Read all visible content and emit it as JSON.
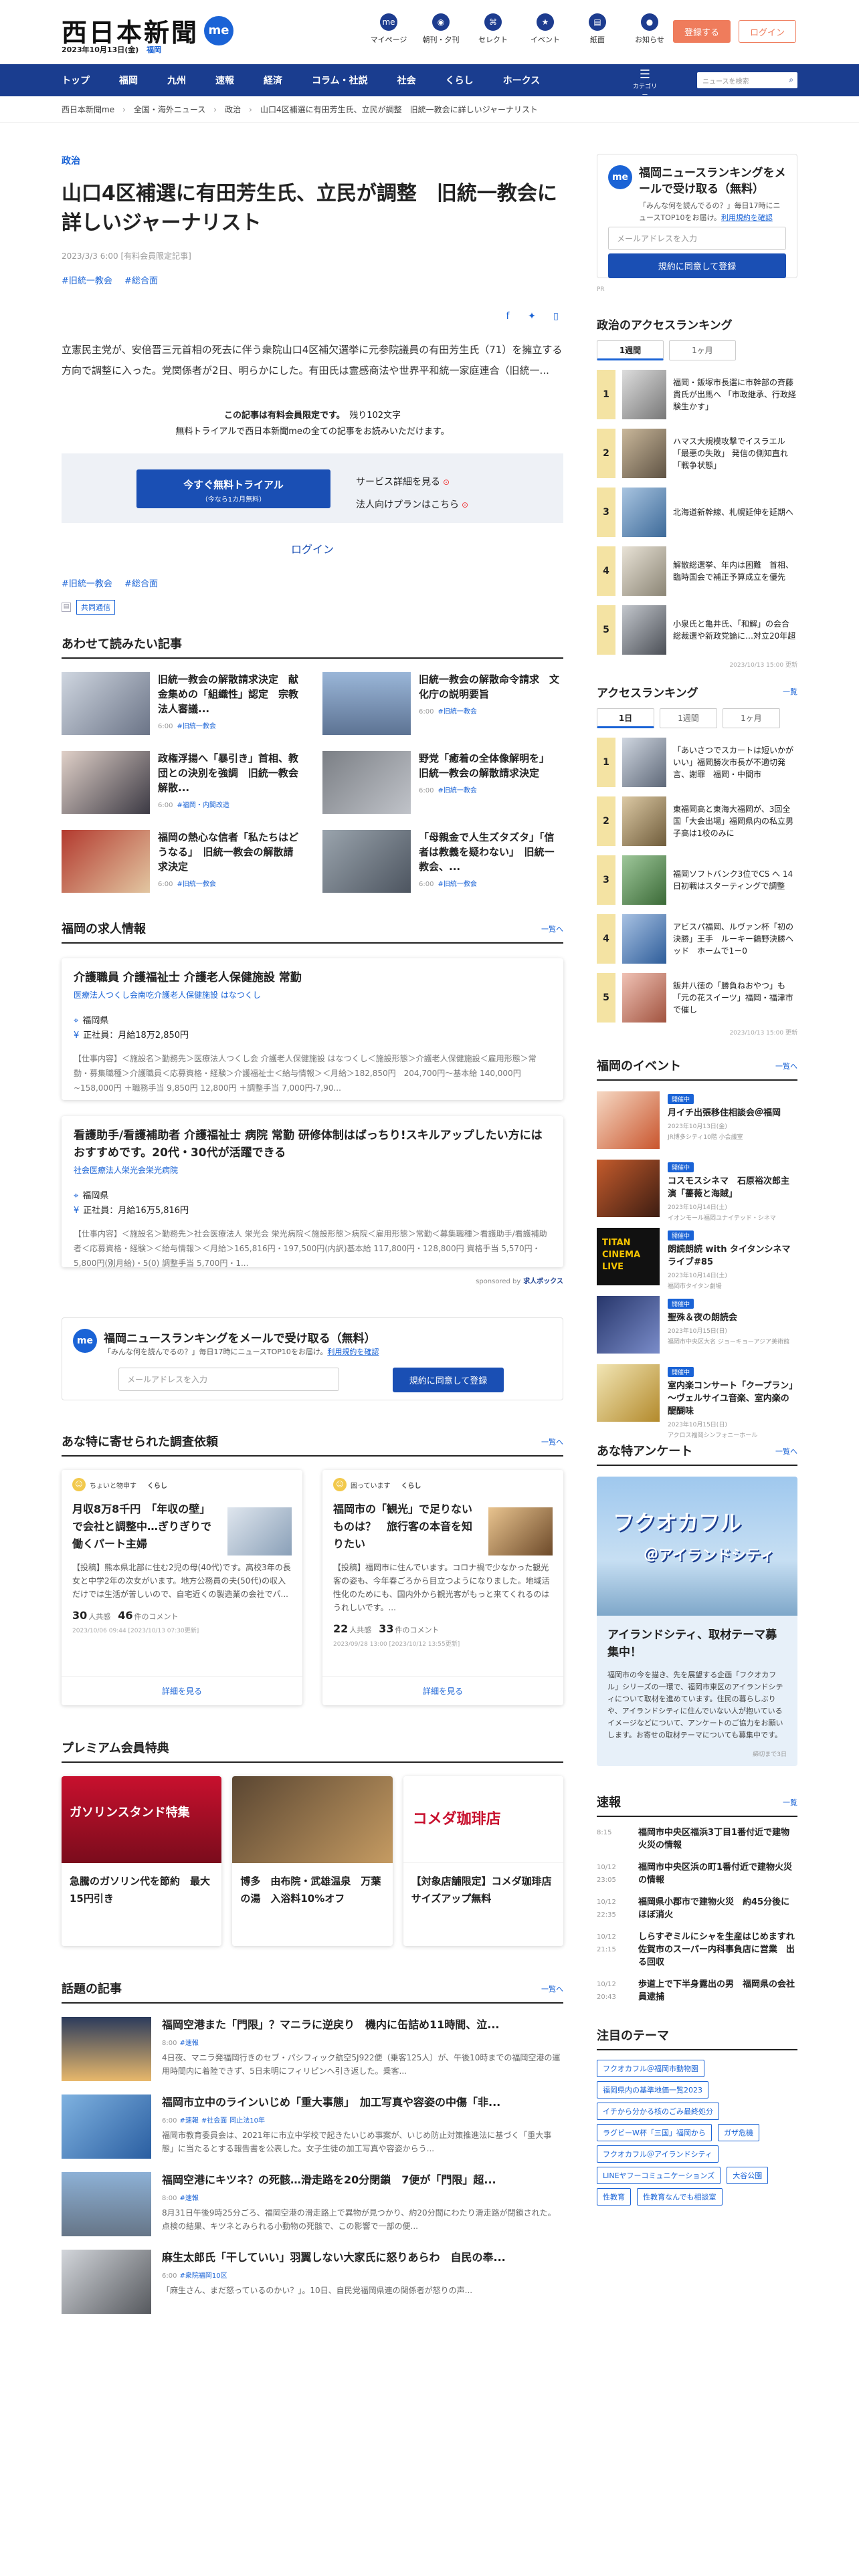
{
  "header": {
    "logo": "西日本新聞",
    "me": "me",
    "date": "2023年10月13日(金)",
    "weather": "福岡",
    "nav": [
      {
        "icon": "me",
        "label": "マイページ"
      },
      {
        "icon": "◉",
        "label": "朝刊・夕刊"
      },
      {
        "icon": "⌘",
        "label": "セレクト"
      },
      {
        "icon": "★",
        "label": "イベント"
      },
      {
        "icon": "▤",
        "label": "紙面"
      },
      {
        "icon": "●",
        "label": "お知らせ"
      }
    ],
    "register": "登録する",
    "login": "ログイン"
  },
  "gnav": {
    "items": [
      "トップ",
      "福岡",
      "九州",
      "速報",
      "経済",
      "コラム・社説",
      "社会",
      "くらし",
      "ホークス"
    ],
    "menu": "カテゴリー",
    "search_placeholder": "ニュースを検索"
  },
  "breadcrumb": [
    "西日本新聞me",
    "全国・海外ニュース",
    "政治",
    "山口4区補選に有田芳生氏、立民が調整　旧統一教会に詳しいジャーナリスト"
  ],
  "article": {
    "category": "政治",
    "title": "山口4区補選に有田芳生氏、立民が調整　旧統一教会に詳しいジャーナリスト",
    "meta": "2023/3/3 6:00 [有料会員限定記事]",
    "tags": [
      "#旧統一教会",
      "#総合面"
    ],
    "lead": "立憲民主党が、安倍晋三元首相の死去に伴う衆院山口4区補欠選挙に元参院議員の有田芳生氏（71）を擁立する方向で調整に入った。党関係者が2日、明らかにした。有田氏は霊感商法や世界平和統一家庭連合（旧統一...",
    "paywall_line1": "この記事は有料会員限定です。",
    "paywall_remaining": "残り102文字",
    "paywall_line2": "無料トライアルで西日本新聞meの全ての記事をお読みいただけます。",
    "trial_button": "今すぐ無料トライアル",
    "trial_sub": "（今なら1カ月無料）",
    "service_link": "サービス詳細を見る",
    "corp_link": "法人向けプランはこちら",
    "login_link": "ログイン",
    "source": "共同通信"
  },
  "related": {
    "title": "あわせて読みたい記事",
    "items": [
      {
        "title": "旧統一教会の解散請求決定　献金集めの「組織性」認定　宗教法人審議...",
        "date": "6:00",
        "tag": "#旧統一教会"
      },
      {
        "title": "旧統一教会の解散命令請求　文化庁の説明要旨",
        "date": "6:00",
        "tag": "#旧統一教会"
      },
      {
        "title": "政権浮揚へ「暴引き」首相、教団との決別を強調　旧統一教会解散...",
        "date": "6:00",
        "tag": "#福岡・内閣改造"
      },
      {
        "title": "野党「癒着の全体像解明を」　旧統一教会の解散請求決定",
        "date": "6:00",
        "tag": "#旧統一教会"
      },
      {
        "title": "福岡の熱心な信者「私たちはどうなる」　旧統一教会の解散請求決定",
        "date": "6:00",
        "tag": "#旧統一教会"
      },
      {
        "title": "「母親金で人生ズタズタ」「信者は教義を疑わない」　旧統一教会、...",
        "date": "6:00",
        "tag": "#旧統一教会"
      }
    ]
  },
  "jobs": {
    "title": "福岡の求人情報",
    "more": "一覧へ",
    "items": [
      {
        "title": "介護職員 介護福祉士 介護老人保健施設 常勤",
        "company": "医療法人つくし会南吃介護老人保健施設 はなつくし",
        "place": "福岡県",
        "salary": "正社員：月給18万2,850円",
        "desc": "【仕事内容】＜施設名＞勤務先＞医療法人つくし会 介護老人保健施設 はなつくし＜施設形態＞介護老人保健施設＜雇用形態＞常勤・募集職種＞介護職員＜応募資格・経験＞介護福祉士＜給与情報＞＜月給＞182,850円　204,700円～基本給 140,000円~158,000円 ＋職務手当 9,850円 12,800円 ＋調整手当 7,000円-7,90..."
      },
      {
        "title": "看護助手/看護補助者 介護福祉士 病院 常勤 研修体制はばっちり!スキルアップしたい方にはおすすめです。20代・30代が活躍できる",
        "company": "社会医療法人栄光会栄光病院",
        "place": "福岡県",
        "salary": "正社員：月給16万5,816円",
        "desc": "【仕事内容】＜施設名＞勤務先＞社会医療法人 栄光会 栄光病院＜施設形態＞病院＜雇用形態＞常勤＜募集職種＞看護助手/看護補助者＜応募資格・経験＞＜給与情報＞＜月給＞165,816円・197,500円(内訳)基本給 117,800円・128,800円 資格手当 5,570円・ 5,800円(別月給)・5(0) 調整手当 5,700円・1..."
      }
    ],
    "sponsor": "sponsored by",
    "sponsor_brand": "求人ボックス"
  },
  "mail": {
    "logo": "me",
    "title": "福岡ニュースランキングをメールで受け取る（無料）",
    "desc": "「みんな何を読んでるの？」毎日17時にニュースTOP10をお届け。",
    "terms": "利用規約を確認",
    "placeholder": "メールアドレスを入力",
    "button": "規約に同意して登録"
  },
  "survey": {
    "title": "あな特に寄せられた調査依頼",
    "more": "一覧へ",
    "items": [
      {
        "author": "ちょいと物申す",
        "cat": "くらし",
        "title": "月収8万8千円　「年収の壁」で会社と調整中…ぎりぎりで働くパート主婦",
        "body": "【投稿】熊本県北部に住む2児の母(40代)です。高校3年の長女と中学2年の次女がいます。地方公務員の夫(50代)の収入だけでは生活が苦しいので、自宅近くの製造業の会社でパ...",
        "count1": "30",
        "count1_label": "人共感",
        "count2": "46",
        "count2_label": "件のコメント",
        "date": "2023/10/06 09:44 [2023/10/13 07:30更新]",
        "link": "詳細を見る"
      },
      {
        "author": "困っています",
        "cat": "くらし",
        "title": "福岡市の「観光」で足りないものは？　旅行客の本音を知りたい",
        "body": "【投稿】福岡市に住んでいます。コロナ禍で少なかった観光客の姿も、今年春ごろから目立つようになりました。地域活性化のためにも、国内外から観光客がもっと来てくれるのはうれしいです。...",
        "count1": "22",
        "count1_label": "人共感",
        "count2": "33",
        "count2_label": "件のコメント",
        "date": "2023/09/28 13:00 [2023/10/12 13:55更新]",
        "link": "詳細を見る"
      }
    ]
  },
  "premium": {
    "title": "プレミアム会員特典",
    "items": [
      {
        "img": "ガソリンスタンド特集",
        "title": "急騰のガソリン代を節約　最大15円引き"
      },
      {
        "img": "",
        "title": "博多　由布院・武雄温泉　万葉の湯　入浴料10%オフ"
      },
      {
        "img": "コメダ珈琲店",
        "title": "【対象店舗限定】コメダ珈琲店 サイズアップ無料"
      }
    ]
  },
  "topics": {
    "title": "話題の記事",
    "more": "一覧へ",
    "items": [
      {
        "title": "福岡空港また「門限」？マニラに逆戻り　機内に缶詰め11時間、泣...",
        "date": "8:00",
        "tag": "#速報",
        "text": "4日夜、マニラ発福岡行きのセブ・パシフィック航空5J922便（乗客125人）が、午後10時までの福岡空港の運用時間内に着陸できず、5日未明にフィリピンへ引き返した。乗客..."
      },
      {
        "title": "福岡市立中のラインいじめ「重大事態」　加工写真や容姿の中傷「非...",
        "date": "6:00",
        "tag": "#速報",
        "tag2": "#社会面",
        "tag3": "同止法10年",
        "text": "福岡市教育委員会は、2021年に市立中学校で起きたいじめ事案が、いじめ防止対策推進法に基づく「重大事態」に当たるとする報告書を公表した。女子生徒の加工写真や容姿からう..."
      },
      {
        "title": "福岡空港にキツネ？の死骸…滑走路を20分閉鎖　7便が「門限」超...",
        "date": "8:00",
        "tag": "#速報",
        "text": "8月31日午後9時25分ごろ、福岡空港の滑走路上で異物が見つかり、約20分間にわたり滑走路が閉鎖された。点検の結果、キツネとみられる小動物の死骸で、この影響で一部の便..."
      },
      {
        "title": "麻生太郎氏「干していい」羽翼しない大家氏に怒りあらわ　自民の奉...",
        "date": "6:00",
        "tag": "#衆院福岡10区",
        "text": "「麻生さん、まだ怒っているのかい？」。10日、自民党福岡県連の関係者が怒りの声..."
      }
    ]
  },
  "side_mail": {
    "logo": "me",
    "title": "福岡ニュースランキングをメールで受け取る（無料）",
    "desc": "「みんな何を読んでるの？」毎日17時にニュースTOP10をお届け。",
    "terms": "利用規約を確認",
    "placeholder": "メールアドレスを入力",
    "button": "規約に同意して登録",
    "pr": "PR"
  },
  "politics_rank": {
    "title": "政治のアクセスランキング",
    "tabs": [
      "1週間",
      "1ヶ月"
    ],
    "items": [
      {
        "n": "1",
        "title": "福岡・飯塚市長選に市幹部の斉藤貴氏が出馬へ 「市政継承、行政経験生かす」"
      },
      {
        "n": "2",
        "title": "ハマス大規模攻撃でイスラエル「最悪の失敗」 発信の側知直れ 「戦争状態」"
      },
      {
        "n": "3",
        "title": "北海道新幹線、札幌延伸を延期へ"
      },
      {
        "n": "4",
        "title": "解散総選挙、年内は困難　首相、臨時国会で補正予算成立を優先"
      },
      {
        "n": "5",
        "title": "小泉氏と亀井氏、「和解」の会合　総裁選や新政党論に…対立20年超"
      }
    ],
    "footer": "2023/10/13 15:00 更新"
  },
  "access_rank": {
    "title": "アクセスランキング",
    "more": "一覧",
    "tabs": [
      "1日",
      "1週間",
      "1ヶ月"
    ],
    "items": [
      {
        "n": "1",
        "title": "「あいさつでスカートは短いかがいい」福岡勝次市長が不適切発言、謝罪　福岡・中間市"
      },
      {
        "n": "2",
        "title": "東福岡高と東海大福岡が、3回全国「大会出場」福岡県内の私立男子高は1校のみに"
      },
      {
        "n": "3",
        "title": "福岡ソフトバンク3位でCS へ 14日初戦はスターティングで調整"
      },
      {
        "n": "4",
        "title": "アビスパ福岡、ルヴァン杯「初の決勝」王手　ルーキー鶴野決勝ヘッド　ホームで1－0"
      },
      {
        "n": "5",
        "title": "飯井八徳の「勝負ねおやつ」も 「元の花スイーツ」福岡・福津市で催し"
      }
    ],
    "footer": "2023/10/13 15:00 更新"
  },
  "events": {
    "title": "福岡のイベント",
    "more": "一覧へ",
    "badge": "開催中",
    "items": [
      {
        "title": "月イチ出張移住相談会＠福岡",
        "date": "2023年10月13日(金)",
        "place": "JR博多シティ10階 小会議室"
      },
      {
        "title": "コスモスシネマ　石原裕次郎主演「薔薇と海賊」",
        "date": "2023年10月14日(土)",
        "place": "イオンモール福岡ユナイテッド・シネマ"
      },
      {
        "title": "朗読朗読 with タイタンシネマライブ#85",
        "date": "2023年10月14日(土)",
        "place": "福岡市タイタン劇場"
      },
      {
        "title": "聖殊＆夜の朗読会",
        "date": "2023年10月15日(日)",
        "place": "福岡市中央区大名 ジョーキョーアジア美術館"
      },
      {
        "title": "室内楽コンサート「クープラン」～ヴェルサイユ音楽、室内楽の醍醐味",
        "date": "2023年10月15日(日)",
        "place": "アクロス福岡シンフォニーホール"
      }
    ]
  },
  "enquete": {
    "title": "あな特アンケート",
    "more": "一覧へ",
    "img_line1": "フクオカフル",
    "img_line2": "＠アイランドシティ",
    "head": "アイランドシティ、取材テーマ募集中！",
    "text": "福岡市の今を描き、先を展望する企画「フクオカフル」シリーズの一環で、福岡市東区のアイランドシティについて取材を進めています。住民の暮らしぶりや、アイランドシティに住んでいない人が抱いているイメージなどについて、アンケートのご協力をお願いします。お寄せの取材テーマについても募集中です。",
    "date": "締切まで3日"
  },
  "sokuho": {
    "title": "速報",
    "more": "一覧",
    "items": [
      {
        "time": "8:15",
        "title": "福岡市中央区福浜3丁目1番付近で建物火災の情報",
        "new": "New"
      },
      {
        "time": "10/12 23:05",
        "title": "福岡市中央区浜の町1番付近で建物火災の情報"
      },
      {
        "time": "10/12 22:35",
        "title": "福岡県小郡市で建物火災　約45分後にほぼ消火"
      },
      {
        "time": "10/12 21:15",
        "title": "しらすぞミルにシャを生産はじめますれ　佐賀市のスーパー内科事負店に営業　出る回収"
      },
      {
        "time": "10/12 20:43",
        "title": "歩道上で下半身露出の男　福岡県の会社員逮捕"
      }
    ]
  },
  "themes": {
    "title": "注目のテーマ",
    "tags": [
      "フクオカフル＠福岡市動物園",
      "福岡県内の基準地価一覧2023",
      "イチから分かる核のごみ最終処分",
      "ラグビーW杯「三国」福岡から",
      "ガザ危機",
      "フクオカフル＠アイランドシティ",
      "LINEヤフーコミュニケーションズ",
      "大谷公園",
      "性教育",
      "性教育なんでも相談室"
    ]
  }
}
